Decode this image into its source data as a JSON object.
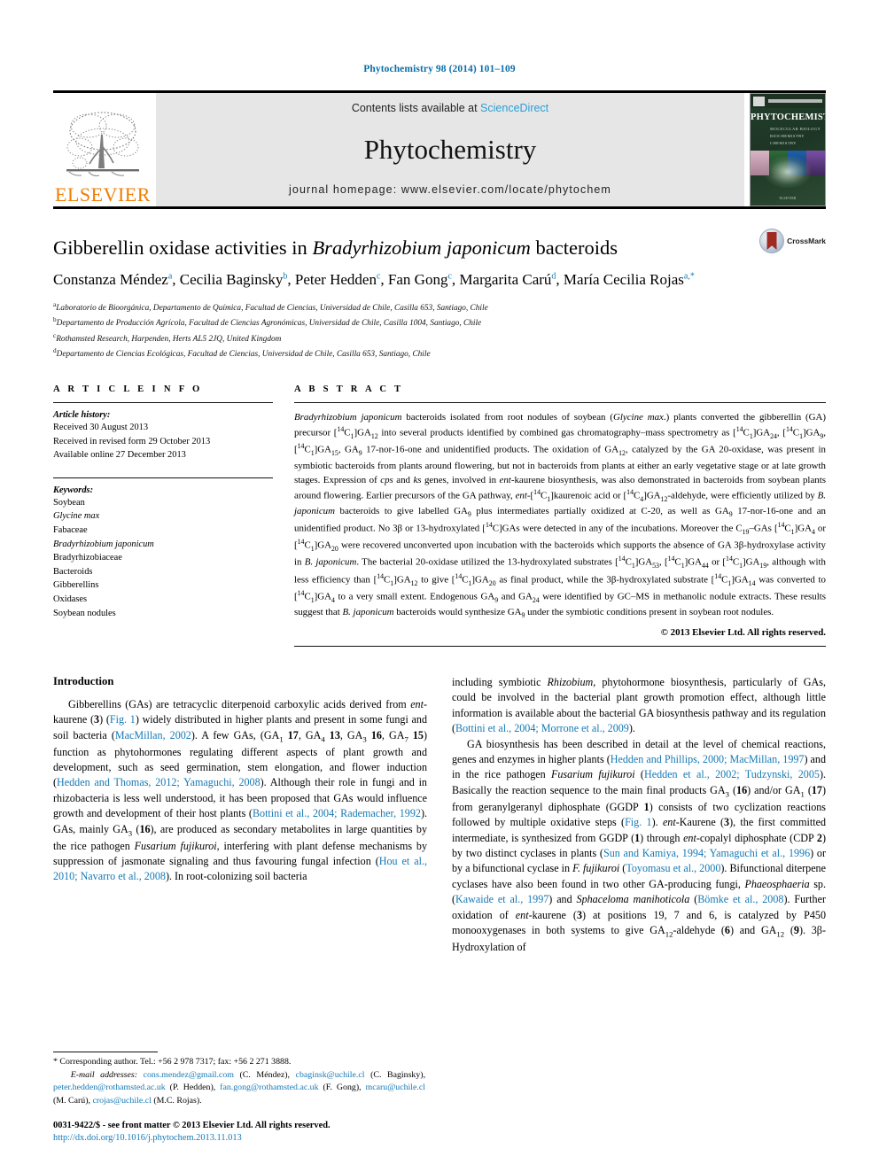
{
  "running_head": "Phytochemistry 98 (2014) 101–109",
  "masthead": {
    "elsevier_wordmark": "ELSEVIER",
    "contents_prefix": "Contents lists available at ",
    "contents_link": "ScienceDirect",
    "journal_title": "Phytochemistry",
    "homepage": "journal homepage: www.elsevier.com/locate/phytochem",
    "cover": {
      "name": "PHYTOCHEMISTRY",
      "subtitle": "MOLECULAR BIOLOGY\nBIOCHEMISTRY\nCHEMISTRY",
      "footer": "ELSEVIER"
    },
    "colors": {
      "elsevier_orange": "#f07d00",
      "sciencedirect_blue": "#2a9fd6",
      "band_grey": "#e6e6e6"
    }
  },
  "article": {
    "title_part1": "Gibberellin oxidase activities in ",
    "title_italic": "Bradyrhizobium japonicum",
    "title_part2": " bacteroids",
    "crossmark_label": "CrossMark",
    "authors": [
      {
        "name": "Constanza Méndez",
        "mark": "a"
      },
      {
        "name": "Cecilia Baginsky",
        "mark": "b"
      },
      {
        "name": "Peter Hedden",
        "mark": "c"
      },
      {
        "name": "Fan Gong",
        "mark": "c"
      },
      {
        "name": "Margarita Carú",
        "mark": "d"
      },
      {
        "name": "María Cecilia Rojas",
        "mark": "a,*"
      }
    ],
    "affiliations": [
      {
        "mark": "a",
        "text": "Laboratorio de Bioorgánica, Departamento de Química, Facultad de Ciencias, Universidad de Chile, Casilla 653, Santiago, Chile"
      },
      {
        "mark": "b",
        "text": "Departamento de Producción Agrícola, Facultad de Ciencias Agronómicas, Universidad de Chile, Casilla 1004, Santiago, Chile"
      },
      {
        "mark": "c",
        "text": "Rothamsted Research, Harpenden, Herts AL5 2JQ, United Kingdom"
      },
      {
        "mark": "d",
        "text": "Departamento de Ciencias Ecológicas, Facultad de Ciencias, Universidad de Chile, Casilla 653, Santiago, Chile"
      }
    ]
  },
  "article_info": {
    "heading": "A R T I C L E   I N F O",
    "history_title": "Article history:",
    "history": [
      "Received 30 August 2013",
      "Received in revised form 29 October 2013",
      "Available online 27 December 2013"
    ],
    "keywords_title": "Keywords:",
    "keywords": [
      "Soybean",
      "Glycine max",
      "Fabaceae",
      "Bradyrhizobium japonicum",
      "Bradyrhizobiaceae",
      "Bacteroids",
      "Gibberellins",
      "Oxidases",
      "Soybean nodules"
    ],
    "keywords_italic_indices": [
      1,
      3
    ]
  },
  "abstract": {
    "heading": "A B S T R A C T",
    "copyright": "© 2013 Elsevier Ltd. All rights reserved."
  },
  "introduction": {
    "heading": "Introduction"
  },
  "footnote": {
    "corresponding": "* Corresponding author. Tel.: +56 2 978 7317; fax: +56 2 271 3888.",
    "email_label": "E-mail addresses:",
    "emails": [
      {
        "address": "cons.mendez@gmail.com",
        "owner": "(C. Méndez)"
      },
      {
        "address": "cbaginsk@uchile.cl",
        "owner": "(C. Baginsky)"
      },
      {
        "address": "peter.hedden@rothamsted.ac.uk",
        "owner": "(P. Hedden)"
      },
      {
        "address": "fan.gong@rothamsted.ac.uk",
        "owner": "(F. Gong)"
      },
      {
        "address": "mcaru@uchile.cl",
        "owner": "(M. Carú)"
      },
      {
        "address": "crojas@uchile.cl",
        "owner": "(M.C. Rojas)"
      }
    ],
    "issn": "0031-9422/$ - see front matter © 2013 Elsevier Ltd. All rights reserved.",
    "doi": "http://dx.doi.org/10.1016/j.phytochem.2013.11.013"
  }
}
